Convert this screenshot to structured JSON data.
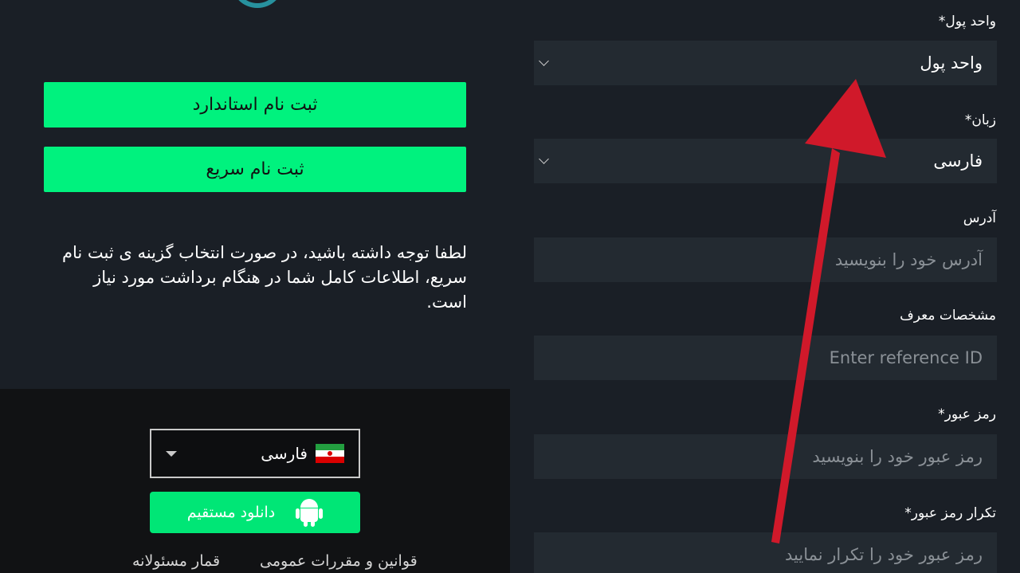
{
  "left": {
    "buttons": {
      "standard_signup": "ثبت نام استاندارد",
      "quick_signup": "ثبت نام سریع"
    },
    "notice": "لطفا توجه داشته باشید، در صورت انتخاب گزینه ی ثبت نام سریع، اطلاعات کامل شما در هنگام برداشت مورد نیاز است."
  },
  "footer": {
    "language": {
      "selected": "فارسی",
      "flag_icon": "iran-flag-icon"
    },
    "download_label": "دانلود مستقیم",
    "download_icon": "android-icon",
    "links": {
      "terms": "قوانین و مقررات عمومی",
      "responsible": "قمار مسئولانه"
    }
  },
  "form": {
    "currency": {
      "label": "واحد پول*",
      "value": "واحد پول"
    },
    "language": {
      "label": "زبان*",
      "value": "فارسی"
    },
    "address": {
      "label": "آدرس",
      "placeholder": "آدرس خود را بنویسید"
    },
    "reference": {
      "label": "مشخصات معرف",
      "placeholder": "Enter reference ID"
    },
    "password": {
      "label": "رمز عبور*",
      "placeholder": "رمز عبور خود را بنویسید"
    },
    "password_repeat": {
      "label": "تکرار رمز عبور*",
      "placeholder": "رمز عبور خود را تکرار نمایید"
    }
  },
  "colors": {
    "accent_green": "#00f27e",
    "annotation_arrow": "#d0192a",
    "panel_bg": "#1a1f26",
    "input_bg": "#232a31"
  }
}
